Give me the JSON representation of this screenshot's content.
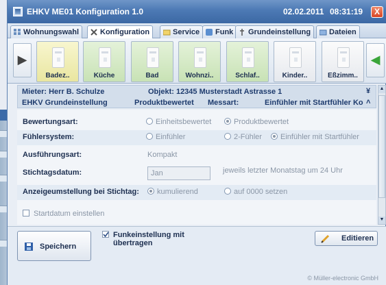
{
  "window": {
    "title": "EHKV ME01  Konfiguration  1.0",
    "date": "02.02.2011",
    "time": "08:31:19",
    "close_glyph": "X"
  },
  "tabs": [
    {
      "label": "Wohnungswahl",
      "icon": "grid-icon",
      "active": false
    },
    {
      "label": "Konfiguration",
      "icon": "tools-icon",
      "active": true
    },
    {
      "label": "Service",
      "icon": "folder-icon",
      "active": false
    },
    {
      "label": "Funk",
      "icon": "wireless-icon",
      "active": false
    },
    {
      "label": "Grundeinstellung",
      "icon": "settings-icon",
      "active": false
    },
    {
      "label": "Dateien",
      "icon": "files-icon",
      "active": false
    }
  ],
  "rooms": [
    {
      "label": "Badez..",
      "color": "yellow"
    },
    {
      "label": "Küche",
      "color": "green"
    },
    {
      "label": "Bad",
      "color": "green"
    },
    {
      "label": "Wohnzi..",
      "color": "green"
    },
    {
      "label": "Schlaf..",
      "color": "green"
    },
    {
      "label": "Kinder..",
      "color": "grey"
    },
    {
      "label": "Eßzimm..",
      "color": "grey"
    }
  ],
  "info": {
    "mieter": "Mieter:  Herr B. Schulze",
    "objekt": "Objekt: 12345 Musterstadt Astrasse 1",
    "grund": "EHKV Grundeinstellung",
    "produkt": "Produktbewertet",
    "messart_label": "Messart:",
    "messart_value": "Einfühler mit Startfühler Ko"
  },
  "form": {
    "bewertungsart_label": "Bewertungsart:",
    "bewertungsart_opt1": "Einheitsbewertet",
    "bewertungsart_opt2": "Produktbewertet",
    "fuehler_label": "Fühlersystem:",
    "fuehler_opt1": "Einfühler",
    "fuehler_opt2": "2-Fühler",
    "fuehler_opt3": "Einfühler mit Startfühler",
    "ausfuehrung_label": "Ausführungsart:",
    "ausfuehrung_value": "Kompakt",
    "stichtag_label": "Stichtagsdatum:",
    "stichtag_value": "Jan",
    "stichtag_hint": "jeweils letzter Monatstag um 24 Uhr",
    "anzeige_label": "Anzeigeumstellung bei Stichtag:",
    "anzeige_opt1": "kumulierend",
    "anzeige_opt2": "auf 0000 setzen",
    "startdatum_label": "Startdatum einstellen"
  },
  "bottom": {
    "save_label": "Speichern",
    "funk_line1": "Funkeinstellung mit",
    "funk_line2": "übertragen",
    "edit_label": "Editieren",
    "copyright": "© Müller-electronic GmbH"
  }
}
